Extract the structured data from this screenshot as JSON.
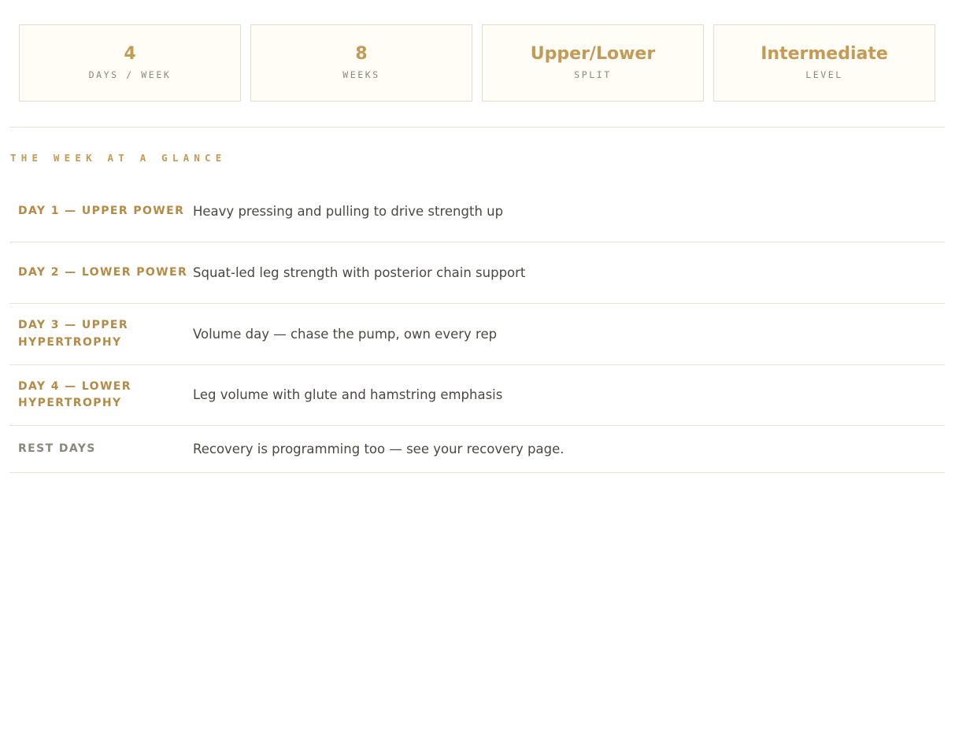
{
  "stats": [
    {
      "value": "4",
      "label": "DAYS / WEEK"
    },
    {
      "value": "8",
      "label": "WEEKS"
    },
    {
      "value": "Upper/Lower",
      "label": "SPLIT"
    },
    {
      "value": "Intermediate",
      "label": "LEVEL"
    }
  ],
  "week": {
    "title": "THE WEEK AT A GLANCE",
    "rows": [
      {
        "day": "DAY 1 — UPPER POWER",
        "desc": "Heavy pressing and pulling to drive strength up"
      },
      {
        "day": "DAY 2 — LOWER POWER",
        "desc": "Squat-led leg strength with posterior chain support"
      },
      {
        "day": "DAY 3 — UPPER HYPERTROPHY",
        "desc": "Volume day — chase the pump, own every rep"
      },
      {
        "day": "DAY 4 — LOWER HYPERTROPHY",
        "desc": "Leg volume with glute and hamstring emphasis"
      },
      {
        "day": "REST DAYS",
        "desc": "Recovery is programming too — see your recovery page."
      }
    ]
  }
}
